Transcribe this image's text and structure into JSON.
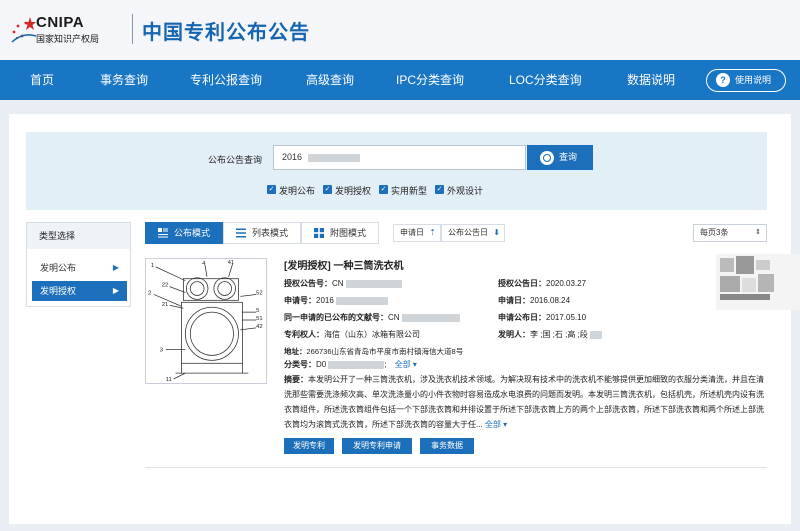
{
  "header": {
    "logo_text": "CNIPA",
    "logo_subtitle": "国家知识产权局",
    "site_title": "中国专利公布公告"
  },
  "nav": {
    "items": [
      "首页",
      "事务查询",
      "专利公报查询",
      "高级查询",
      "IPC分类查询",
      "LOC分类查询",
      "数据说明"
    ],
    "help_label": "使用说明"
  },
  "search": {
    "label": "公布公告查询",
    "value": "2016",
    "button_label": "查询",
    "checkboxes": [
      {
        "label": "发明公布",
        "checked": true
      },
      {
        "label": "发明授权",
        "checked": true
      },
      {
        "label": "实用新型",
        "checked": true
      },
      {
        "label": "外观设计",
        "checked": true
      }
    ]
  },
  "sidebar": {
    "title": "类型选择",
    "items": [
      {
        "label": "发明公布",
        "active": false
      },
      {
        "label": "发明授权",
        "active": true
      }
    ]
  },
  "toolbar": {
    "tabs": [
      {
        "label": "公布模式",
        "icon": "doc-list-icon",
        "active": true
      },
      {
        "label": "列表模式",
        "icon": "list-icon",
        "active": false
      },
      {
        "label": "附图模式",
        "icon": "grid-icon",
        "active": false
      }
    ],
    "sort_apply_date": "申请日",
    "sort_pub_date": "公布公告日",
    "per_page": "每页3条"
  },
  "result": {
    "title": "[发明授权] 一种三筒洗衣机",
    "grant_no_label": "授权公告号：",
    "grant_no_value": "CN",
    "grant_date_label": "授权公告日：",
    "grant_date_value": "2020.03.27",
    "app_no_label": "申请号：",
    "app_no_value": "2016",
    "app_date_label": "申请日：",
    "app_date_value": "2016.08.24",
    "prior_pub_label": "同一申请的已公布的文献号：",
    "prior_pub_value": "CN",
    "prior_pub_date_label": "申请公布日：",
    "prior_pub_date_value": "2017.05.10",
    "patentee_label": "专利权人：",
    "patentee_value": "海信（山东）冰箱有限公司",
    "inventor_label": "发明人：",
    "inventor_value": "李  ;国  ;石  ;高  ;段",
    "address_label": "地址：",
    "address_value": "266736山东省青岛市平度市南村镇海信大道8号",
    "class_label": "分类号：",
    "class_value": "D0",
    "class_more": "全部",
    "abstract_label": "摘要：",
    "abstract_text": "本发明公开了一种三筒洗衣机，涉及洗衣机技术领域。为解决现有技术中的洗衣机不能够提供更加细致的衣服分类清洗，并且在清洗那些需要洗涤频次高、单次洗涤量小的小件衣物时容易造成水电浪费的问题而发明。本发明三筒洗衣机，包括机壳，所述机壳内设有洗衣筒组件，所述洗衣筒组件包括一个下部洗衣筒和并排设置于所述下部洗衣筒上方的两个上部洗衣筒，所述下部洗衣筒和两个所述上部洗衣筒均为滚筒式洗衣筒，所述下部洗衣筒的容量大于任...",
    "abstract_more": "全部",
    "actions": [
      "发明专利",
      "发明专利申请",
      "事务数据"
    ],
    "drawing_labels": [
      "1",
      "4",
      "41",
      "2",
      "22",
      "21",
      "52",
      "5",
      "51",
      "42",
      "3",
      "11"
    ]
  }
}
